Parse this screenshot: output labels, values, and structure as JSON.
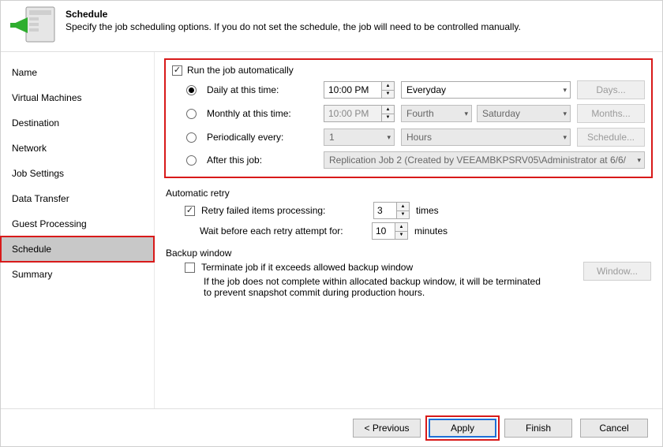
{
  "header": {
    "title": "Schedule",
    "description": "Specify the job scheduling options. If you do not set the schedule, the job will need to be controlled manually."
  },
  "sidebar": {
    "items": [
      "Name",
      "Virtual Machines",
      "Destination",
      "Network",
      "Job Settings",
      "Data Transfer",
      "Guest Processing",
      "Schedule",
      "Summary"
    ],
    "selected_index": 7
  },
  "schedule": {
    "run_auto_label": "Run the job automatically",
    "run_auto_checked": true,
    "options": {
      "daily": {
        "label": "Daily at this time:",
        "time": "10:00 PM",
        "day": "Everyday",
        "button": "Days...",
        "selected": true
      },
      "monthly": {
        "label": "Monthly at this time:",
        "time": "10:00 PM",
        "ordinal": "Fourth",
        "weekday": "Saturday",
        "button": "Months...",
        "selected": false
      },
      "period": {
        "label": "Periodically every:",
        "value": "1",
        "unit": "Hours",
        "button": "Schedule...",
        "selected": false
      },
      "after": {
        "label": "After this job:",
        "job": "Replication Job 2 (Created by VEEAMBKPSRV05\\Administrator at 6/6/",
        "selected": false
      }
    }
  },
  "retry": {
    "section": "Automatic retry",
    "enable_label": "Retry failed items processing:",
    "enable_checked": true,
    "retries": "3",
    "times_label": "times",
    "wait_label": "Wait before each retry attempt for:",
    "wait_minutes": "10",
    "minutes_label": "minutes"
  },
  "backup_window": {
    "section": "Backup window",
    "terminate_label": "Terminate job if it exceeds allowed backup window",
    "terminate_checked": false,
    "button": "Window...",
    "note": "If the job does not complete within allocated backup window, it will be terminated to prevent snapshot commit during production hours."
  },
  "footer": {
    "previous": "< Previous",
    "apply": "Apply",
    "finish": "Finish",
    "cancel": "Cancel"
  }
}
